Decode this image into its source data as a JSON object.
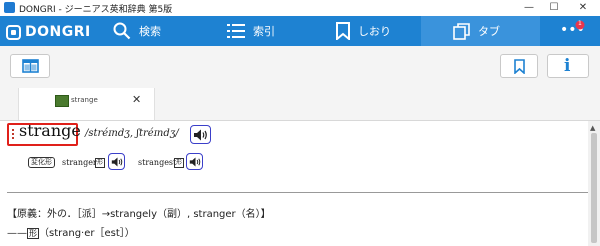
{
  "window": {
    "title": "DONGRI - ジーニアス英和辞典 第5版",
    "minimize": "—",
    "maximize": "☐",
    "close": "✕"
  },
  "nav": {
    "logo_text": "DONGRI",
    "items": [
      {
        "label": "検索",
        "icon": "search-icon"
      },
      {
        "label": "索引",
        "icon": "list-icon"
      },
      {
        "label": "しおり",
        "icon": "bookmark-icon"
      },
      {
        "label": "タブ",
        "icon": "tabs-icon"
      }
    ],
    "more_label": "•••",
    "badge_count": "1",
    "colors": {
      "bar": "#1e82d2",
      "active": "#3a93dc",
      "badge": "#e8364d"
    }
  },
  "toolbar": {
    "layout_icon": "layout-panel-icon",
    "bookmark_icon": "bookmark-icon",
    "info_label": "i"
  },
  "tabs": [
    {
      "label": "strange",
      "close": "✕"
    }
  ],
  "entry": {
    "headword": "strange",
    "pronunciation": "/stréɪndʒ, ʃtréɪndʒ/",
    "forms_tag": "変化形",
    "forms": [
      {
        "word": "stranger",
        "pos": "形"
      },
      {
        "word": "strangest",
        "pos": "形"
      }
    ],
    "etymology": "【原義：外の．［派］→strangely（副）, stranger（名）】",
    "line2_prefix": "——",
    "line2_pos": "形",
    "line2_text": "（strang·er［est］）"
  },
  "colors": {
    "highlight": "#e0201a",
    "speaker": "#3b3fc9"
  }
}
